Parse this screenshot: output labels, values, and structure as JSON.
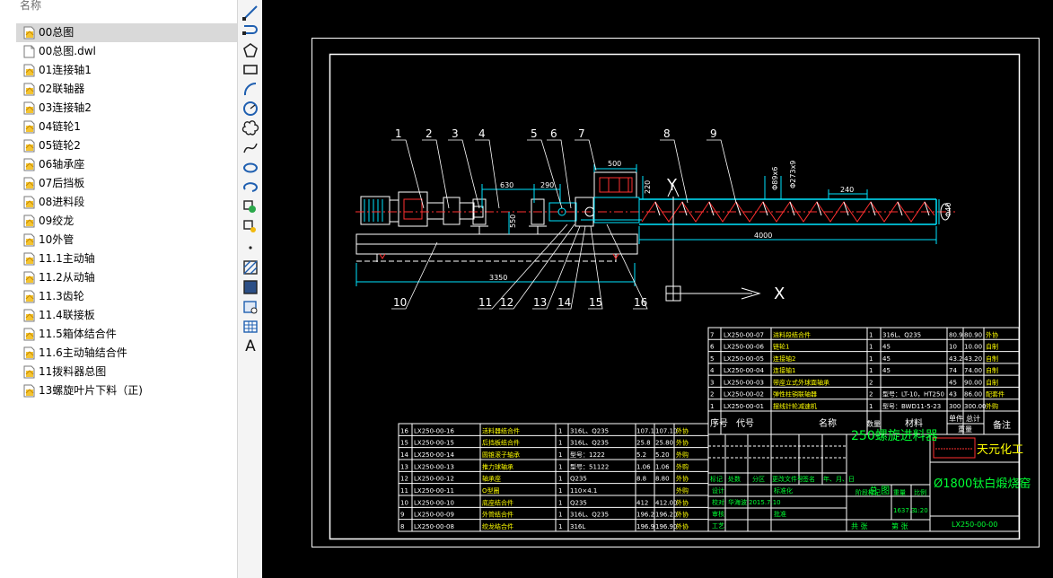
{
  "file_panel": {
    "column_header": "名称",
    "files": [
      {
        "name": "00总图",
        "type": "dwg",
        "selected": true
      },
      {
        "name": "00总图.dwl",
        "type": "file",
        "selected": false
      },
      {
        "name": "01连接轴1",
        "type": "dwg",
        "selected": false
      },
      {
        "name": "02联轴器",
        "type": "dwg",
        "selected": false
      },
      {
        "name": "03连接轴2",
        "type": "dwg",
        "selected": false
      },
      {
        "name": "04链轮1",
        "type": "dwg",
        "selected": false
      },
      {
        "name": "05链轮2",
        "type": "dwg",
        "selected": false
      },
      {
        "name": "06轴承座",
        "type": "dwg",
        "selected": false
      },
      {
        "name": "07后挡板",
        "type": "dwg",
        "selected": false
      },
      {
        "name": "08进料段",
        "type": "dwg",
        "selected": false
      },
      {
        "name": "09绞龙",
        "type": "dwg",
        "selected": false
      },
      {
        "name": "10外管",
        "type": "dwg",
        "selected": false
      },
      {
        "name": "11.1主动轴",
        "type": "dwg",
        "selected": false
      },
      {
        "name": "11.2从动轴",
        "type": "dwg",
        "selected": false
      },
      {
        "name": "11.3齿轮",
        "type": "dwg",
        "selected": false
      },
      {
        "name": "11.4联接板",
        "type": "dwg",
        "selected": false
      },
      {
        "name": "11.5箱体结合件",
        "type": "dwg",
        "selected": false
      },
      {
        "name": "11.6主动轴结合件",
        "type": "dwg",
        "selected": false
      },
      {
        "name": "11拨料器总图",
        "type": "dwg",
        "selected": false
      },
      {
        "name": "13螺旋叶片下料（正)",
        "type": "dwg",
        "selected": false
      }
    ]
  },
  "toolbar": {
    "tools": [
      "line-icon",
      "polyline-icon",
      "polygon-icon",
      "rectangle-icon",
      "arc-icon",
      "circle-icon",
      "revision-cloud-icon",
      "spline-icon",
      "ellipse-icon",
      "ellipse-arc-icon",
      "insert-block-icon",
      "make-block-icon",
      "point-icon",
      "hatch-icon",
      "gradient-icon",
      "region-icon",
      "table-icon",
      "multiline-text-icon"
    ],
    "text_tool_label": "A"
  },
  "drawing": {
    "colors": {
      "background": "#000000",
      "frame": "#ffffff",
      "dim": "#00e5ff",
      "accent": "#ff3030",
      "text_green": "#00ff33",
      "text_yellow": "#ffff00"
    },
    "balloons_top": [
      "1",
      "2",
      "3",
      "4",
      "5",
      "6",
      "7",
      "8",
      "9"
    ],
    "balloons_bottom": [
      "10",
      "11",
      "12",
      "13",
      "14",
      "15",
      "16"
    ],
    "dimensions": {
      "d630": "630",
      "d290": "290",
      "d500": "500",
      "d220": "220",
      "d240": "240",
      "d4000": "4000",
      "d3350": "3350",
      "d550": "550",
      "phi89": "Φ89x6",
      "phi273": "Φ273x9",
      "phi40": "Φ40"
    },
    "axis_labels": {
      "y": "Y",
      "x": "X"
    },
    "bom_upper": [
      {
        "no": "7",
        "code": "LX250-00-07",
        "name": "进料段结合件",
        "qty": "1",
        "material": "316L、Q235",
        "unit": "80.9",
        "total": "80.90",
        "note": "外协"
      },
      {
        "no": "6",
        "code": "LX250-00-06",
        "name": "链轮1",
        "qty": "1",
        "material": "45",
        "unit": "10",
        "total": "10.00",
        "note": "自制"
      },
      {
        "no": "5",
        "code": "LX250-00-05",
        "name": "连接轴2",
        "qty": "1",
        "material": "45",
        "unit": "43.2",
        "total": "43.20",
        "note": "自制"
      },
      {
        "no": "4",
        "code": "LX250-00-04",
        "name": "连接轴1",
        "qty": "1",
        "material": "45",
        "unit": "74",
        "total": "74.00",
        "note": "自制"
      },
      {
        "no": "3",
        "code": "LX250-00-03",
        "name": "带座立式外球面轴承",
        "qty": "2",
        "material": "",
        "unit": "45",
        "total": "90.00",
        "note": "自制"
      },
      {
        "no": "2",
        "code": "LX250-00-02",
        "name": "弹性柱销联轴器",
        "qty": "2",
        "material": "型号：LT-10，HT250",
        "unit": "43",
        "total": "86.00",
        "note": "配套件"
      },
      {
        "no": "1",
        "code": "LX250-00-01",
        "name": "摆线针轮减速机",
        "qty": "1",
        "material": "型号：BWD11-5-23",
        "unit": "300",
        "total": "300.00",
        "note": "外购"
      }
    ],
    "bom_upper_header": {
      "no": "序号",
      "code": "代号",
      "name": "名称",
      "qty": "数量",
      "material": "材料",
      "unit": "单件",
      "total": "总计",
      "weight": "重量",
      "note": "备注"
    },
    "bom_lower": [
      {
        "no": "16",
        "code": "LX250-00-16",
        "name": "活料器结合件",
        "qty": "1",
        "material": "316L、Q235",
        "unit": "107.1",
        "total": "107.10",
        "note": "外协"
      },
      {
        "no": "15",
        "code": "LX250-00-15",
        "name": "后挡板结合件",
        "qty": "1",
        "material": "316L、Q235",
        "unit": "25.8",
        "total": "25.80",
        "note": "外协"
      },
      {
        "no": "14",
        "code": "LX250-00-14",
        "name": "圆锥滚子轴承",
        "qty": "1",
        "material": "型号：1222",
        "unit": "5.2",
        "total": "5.20",
        "note": "外购"
      },
      {
        "no": "13",
        "code": "LX250-00-13",
        "name": "推力球轴承",
        "qty": "1",
        "material": "型号：51122",
        "unit": "1.06",
        "total": "1.06",
        "note": "外购"
      },
      {
        "no": "12",
        "code": "LX250-00-12",
        "name": "轴承座",
        "qty": "1",
        "material": "Q235",
        "unit": "8.8",
        "total": "8.80",
        "note": "外协"
      },
      {
        "no": "11",
        "code": "LX250-00-11",
        "name": "O型圈",
        "qty": "1",
        "material": "110×4.1",
        "unit": "",
        "total": "",
        "note": "外购"
      },
      {
        "no": "10",
        "code": "LX250-00-10",
        "name": "底座结合件",
        "qty": "1",
        "material": "Q235",
        "unit": "412",
        "total": "412.00",
        "note": "外协"
      },
      {
        "no": "9",
        "code": "LX250-00-09",
        "name": "外管结合件",
        "qty": "1",
        "material": "316L、Q235",
        "unit": "196.2",
        "total": "196.20",
        "note": "外协"
      },
      {
        "no": "8",
        "code": "LX250-00-08",
        "name": "绞龙结合件",
        "qty": "1",
        "material": "316L",
        "unit": "196.9",
        "total": "196.90",
        "note": "外协"
      }
    ],
    "title_block": {
      "product_name": "250螺旋进料器",
      "sub_label": "总   图",
      "company": "天元化工",
      "project": "Ø1800钛白煅烧窑",
      "drawing_no": "LX250-00-00",
      "weight": "1637.3",
      "scale": "1:20",
      "stage_label": "阶段标记",
      "weight_label": "重量",
      "scale_label": "比例",
      "sheet_total": "共   张",
      "sheet_no": "第   张",
      "row_labels": [
        "标记",
        "处数",
        "分区",
        "更改文件号",
        "签名",
        "年、月、日"
      ],
      "roles": [
        "设计",
        "校对",
        "审核",
        "工艺",
        "标准化",
        "批准"
      ],
      "designer": "华海波",
      "date": "2015.7.10"
    }
  }
}
